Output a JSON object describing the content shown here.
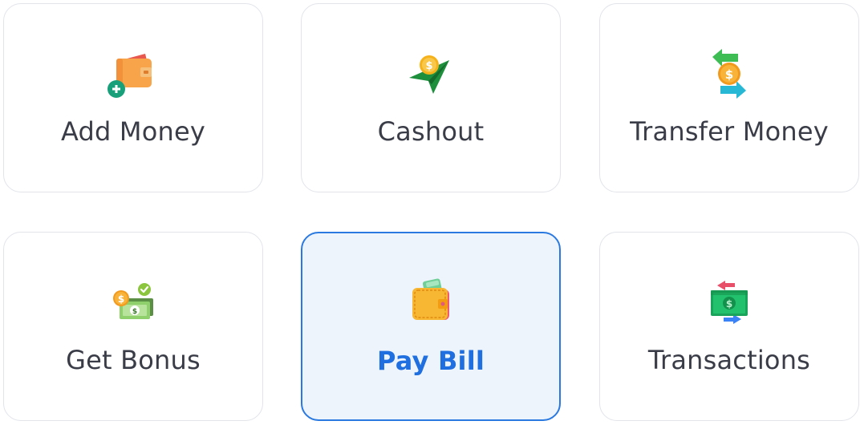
{
  "menu": {
    "items": [
      {
        "label": "Add Money",
        "icon": "wallet-plus-icon",
        "selected": false
      },
      {
        "label": "Cashout",
        "icon": "cash-send-icon",
        "selected": false
      },
      {
        "label": "Transfer Money",
        "icon": "money-transfer-icon",
        "selected": false
      },
      {
        "label": "Get Bonus",
        "icon": "bonus-cash-icon",
        "selected": false
      },
      {
        "label": "Pay Bill",
        "icon": "wallet-icon",
        "selected": true
      },
      {
        "label": "Transactions",
        "icon": "banknote-exchange-icon",
        "selected": false
      }
    ]
  },
  "colors": {
    "accent": "#1f6fe0",
    "active_background": "#eef4fc",
    "card_border": "#e2e4ea",
    "label_text": "#3a3d47"
  }
}
